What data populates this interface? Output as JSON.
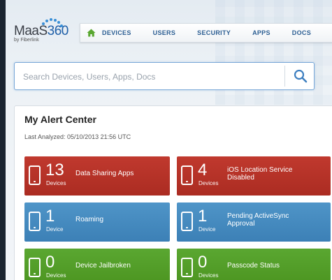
{
  "app": {
    "logo_text_prefix": "MaaS",
    "logo_text_number": "360",
    "logo_sub": "by Fiberlink"
  },
  "nav": {
    "home_icon": "home-icon",
    "items": [
      "DEVICES",
      "USERS",
      "SECURITY",
      "APPS",
      "DOCS"
    ]
  },
  "search": {
    "placeholder": "Search Devices, Users, Apps, Docs",
    "value": "",
    "icon": "search-icon"
  },
  "alert_center": {
    "title": "My Alert Center",
    "last_analyzed": "Last Analyzed: 05/10/2013 21:56 UTC",
    "tiles": [
      {
        "count": "13",
        "unit": "Devices",
        "label": "Data Sharing Apps",
        "color": "#b83227"
      },
      {
        "count": "4",
        "unit": "Devices",
        "label": "iOS Location Service Disabled",
        "color": "#b83227"
      },
      {
        "count": "1",
        "unit": "Device",
        "label": "Roaming",
        "color": "#4589bf"
      },
      {
        "count": "1",
        "unit": "Device",
        "label": "Pending ActiveSync Approval",
        "color": "#4589bf"
      },
      {
        "count": "0",
        "unit": "Devices",
        "label": "Device Jailbroken",
        "color": "#53a029"
      },
      {
        "count": "0",
        "unit": "Devices",
        "label": "Passcode Status",
        "color": "#53a029"
      }
    ]
  }
}
